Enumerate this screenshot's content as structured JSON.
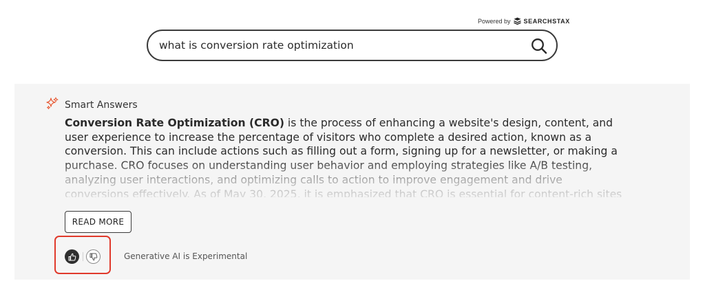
{
  "powered": {
    "prefix": "Powered by",
    "brand": "SEARCHSTAX"
  },
  "search": {
    "value": "what is conversion rate optimization",
    "placeholder": ""
  },
  "answers": {
    "title": "Smart Answers",
    "bold_term": "Conversion Rate Optimization (CRO)",
    "body": " is the process of enhancing a website's design, content, and user experience to increase the percentage of visitors who complete a desired action, known as a conversion. This can include actions such as filling out a form, signing up for a newsletter, or making a purchase. CRO focuses on understanding user behavior and employing strategies like A/B testing, analyzing user interactions, and optimizing calls to action to improve engagement and drive conversions effectively. As of May 30, 2025, it is emphasized that CRO is essential for content-rich sites",
    "read_more_label": "READ MORE",
    "disclaimer": "Generative AI is Experimental"
  },
  "colors": {
    "accent": "#e0392b",
    "panel_bg": "#f5f5f5",
    "sparkle": "#e8603c"
  }
}
